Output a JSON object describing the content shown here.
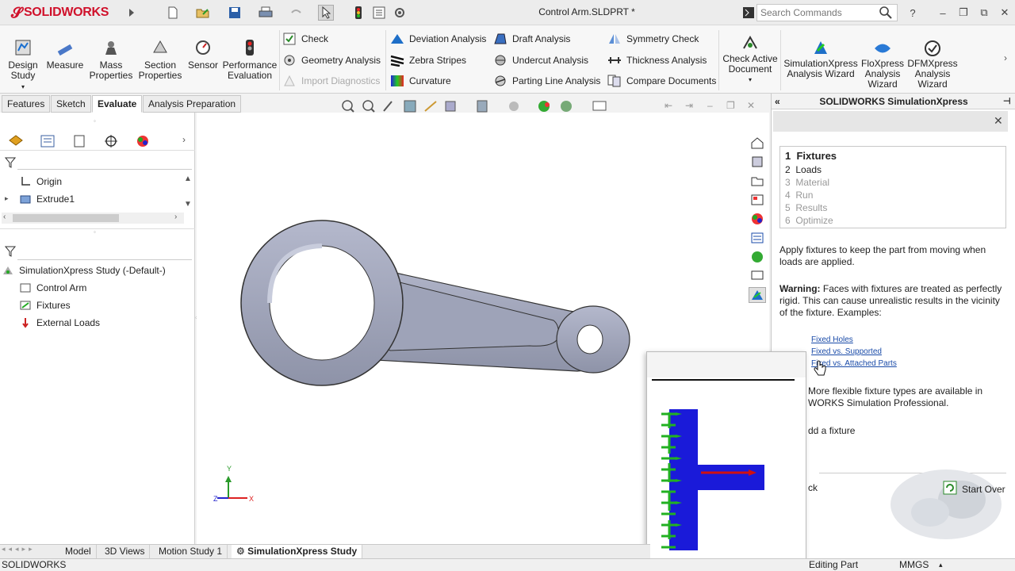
{
  "app": {
    "brand": "SOLIDWORKS",
    "brand_prefix": "3DS",
    "doc_title": "Control Arm.SLDPRT *"
  },
  "search": {
    "placeholder": "Search Commands"
  },
  "window": {
    "help": "?",
    "minimize": "–",
    "restore": "❐",
    "close": "✕"
  },
  "ribbon": {
    "big": [
      {
        "label": "Design\nStudy",
        "icon": "design-study-icon"
      },
      {
        "label": "Measure",
        "icon": "measure-icon"
      },
      {
        "label": "Mass\nProperties",
        "icon": "mass-properties-icon"
      },
      {
        "label": "Section\nProperties",
        "icon": "section-properties-icon"
      },
      {
        "label": "Sensor",
        "icon": "sensor-icon"
      },
      {
        "label": "Performance\nEvaluation",
        "icon": "performance-evaluation-icon"
      }
    ],
    "check": "Check",
    "geometry_analysis": "Geometry Analysis",
    "import_diagnostics": "Import Diagnostics",
    "deviation_analysis": "Deviation Analysis",
    "zebra_stripes": "Zebra Stripes",
    "curvature": "Curvature",
    "draft_analysis": "Draft Analysis",
    "undercut_analysis": "Undercut Analysis",
    "parting_line_analysis": "Parting Line Analysis",
    "symmetry_check": "Symmetry Check",
    "thickness_analysis": "Thickness Analysis",
    "compare_documents": "Compare Documents",
    "check_active_document": "Check Active\nDocument",
    "simxpress_wizard": "SimulationXpress\nAnalysis Wizard",
    "floxpress_wizard": "FloXpress\nAnalysis\nWizard",
    "dfmxpress_wizard": "DFMXpress\nAnalysis\nWizard"
  },
  "tabs": [
    "Features",
    "Sketch",
    "Evaluate",
    "Analysis Preparation"
  ],
  "active_tab": "Evaluate",
  "tree_top": [
    {
      "label": "Origin"
    },
    {
      "label": "Extrude1"
    }
  ],
  "tree_bottom": [
    {
      "label": "SimulationXpress Study (-Default-)"
    },
    {
      "label": "Control Arm"
    },
    {
      "label": "Fixtures"
    },
    {
      "label": "External Loads"
    }
  ],
  "triad": {
    "x": "X",
    "y": "Y",
    "z": "Z"
  },
  "simxpress": {
    "header": "SOLIDWORKS SimulationXpress",
    "steps": [
      {
        "num": "1",
        "label": "Fixtures"
      },
      {
        "num": "2",
        "label": "Loads"
      },
      {
        "num": "3",
        "label": "Material"
      },
      {
        "num": "4",
        "label": "Run"
      },
      {
        "num": "5",
        "label": "Results"
      },
      {
        "num": "6",
        "label": "Optimize"
      }
    ],
    "intro": "Apply fixtures to keep the part from moving when loads are applied.",
    "warning_label": "Warning:",
    "warning_text": " Faces with fixtures are treated as perfectly rigid. This can cause unrealistic results in the vicinity of the fixture. Examples:",
    "links": [
      "Fixed Holes",
      "Fixed vs. Supported",
      "Fixed vs. Attached Parts"
    ],
    "more_text": "More flexible fixture types are available in\nWORKS Simulation Professional.",
    "add_fixture": "dd a fixture",
    "back": "ck",
    "start_over": "Start Over"
  },
  "bottom_tabs": [
    "Model",
    "3D Views",
    "Motion Study 1",
    "SimulationXpress Study"
  ],
  "active_bottom_tab": "SimulationXpress Study",
  "status": {
    "left": "SOLIDWORKS",
    "editing": "Editing Part",
    "units": "MMGS"
  },
  "colors": {
    "brand": "#d0112b",
    "part": "#9ea3b8",
    "fixture_green": "#22b122",
    "body_blue": "#1a1ad9",
    "load_red": "#d01010"
  }
}
